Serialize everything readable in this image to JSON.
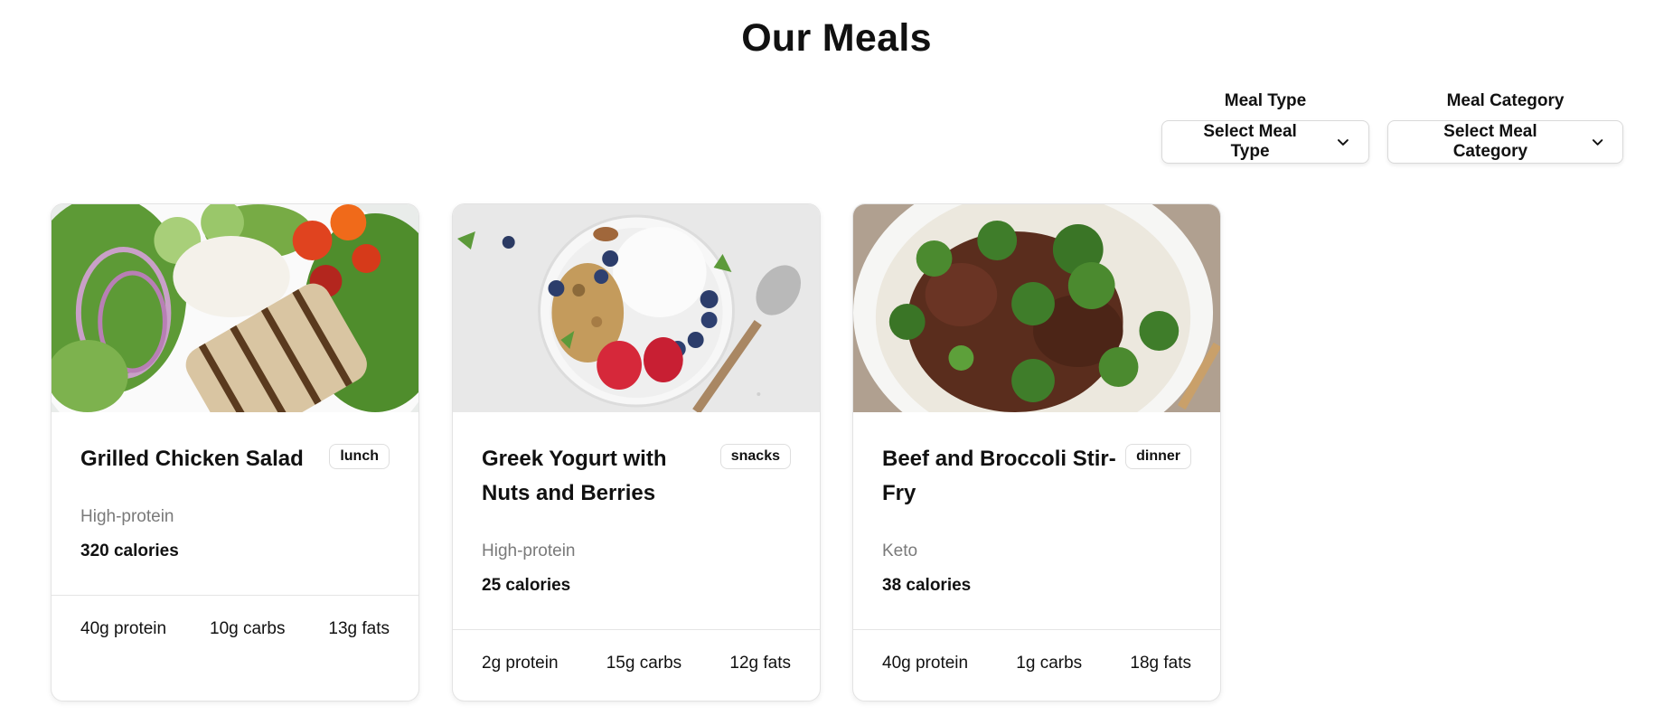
{
  "page": {
    "title": "Our Meals"
  },
  "filters": {
    "meal_type": {
      "label": "Meal Type",
      "value": "Select Meal Type"
    },
    "meal_category": {
      "label": "Meal Category",
      "value": "Select Meal Category"
    }
  },
  "meals": [
    {
      "name": "Grilled Chicken Salad",
      "badge": "lunch",
      "category": "High-protein",
      "calories": "320 calories",
      "protein": "40g protein",
      "carbs": "10g carbs",
      "fats": "13g fats",
      "image": "grilled-chicken-salad-photo"
    },
    {
      "name": "Greek Yogurt with Nuts and Berries",
      "badge": "snacks",
      "category": "High-protein",
      "calories": "25 calories",
      "protein": "2g protein",
      "carbs": "15g carbs",
      "fats": "12g fats",
      "image": "greek-yogurt-bowl-photo"
    },
    {
      "name": "Beef and Broccoli Stir-Fry",
      "badge": "dinner",
      "category": "Keto",
      "calories": "38 calories",
      "protein": "40g protein",
      "carbs": "1g carbs",
      "fats": "18g fats",
      "image": "beef-broccoli-stir-fry-photo"
    }
  ],
  "icons": {
    "dropdown": "chevron-down-icon"
  }
}
